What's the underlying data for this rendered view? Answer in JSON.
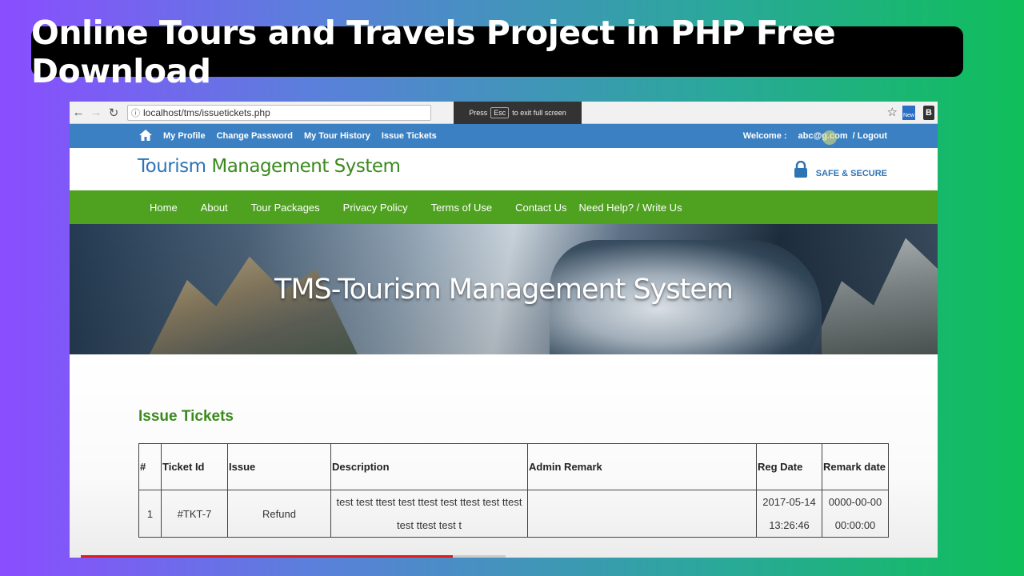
{
  "banner": {
    "title": "Online Tours and Travels Project in PHP Free Download"
  },
  "browser": {
    "url": "localhost/tms/issuetickets.php",
    "fullscreen_press": "Press",
    "fullscreen_key": "Esc",
    "fullscreen_msg": "to exit full screen",
    "ext_label": "New",
    "ext2_label": "B"
  },
  "top_bar": {
    "links": [
      "My Profile",
      "Change Password",
      "My Tour History",
      "Issue Tickets"
    ],
    "welcome_label": "Welcome :",
    "user_email": "abc@g.com",
    "logout": "/ Logout"
  },
  "header": {
    "logo_part1": "Tourism",
    "logo_part2": "Management System",
    "secure_label": "SAFE & SECURE"
  },
  "nav": [
    "Home",
    "About",
    "Tour Packages",
    "Privacy Policy",
    "Terms of Use",
    "Contact Us",
    "Need Help? / Write Us"
  ],
  "hero": {
    "title": "TMS-Tourism Management System"
  },
  "page": {
    "heading": "Issue Tickets"
  },
  "table": {
    "headers": [
      "#",
      "Ticket Id",
      "Issue",
      "Description",
      "Admin Remark",
      "Reg Date",
      "Remark date"
    ],
    "rows": [
      {
        "num": "1",
        "ticket_id": "#TKT-7",
        "issue": "Refund",
        "description": "test test ttest test ttest test ttest test ttest test ttest test t",
        "admin_remark": "",
        "reg_date": "2017-05-14 13:26:46",
        "remark_date": "0000-00-00 00:00:00"
      }
    ]
  },
  "colors": {
    "top_bar": "#3b80c2",
    "nav": "#4ea21f",
    "heading_green": "#3b8a1e",
    "logo_blue": "#2e74b5"
  }
}
